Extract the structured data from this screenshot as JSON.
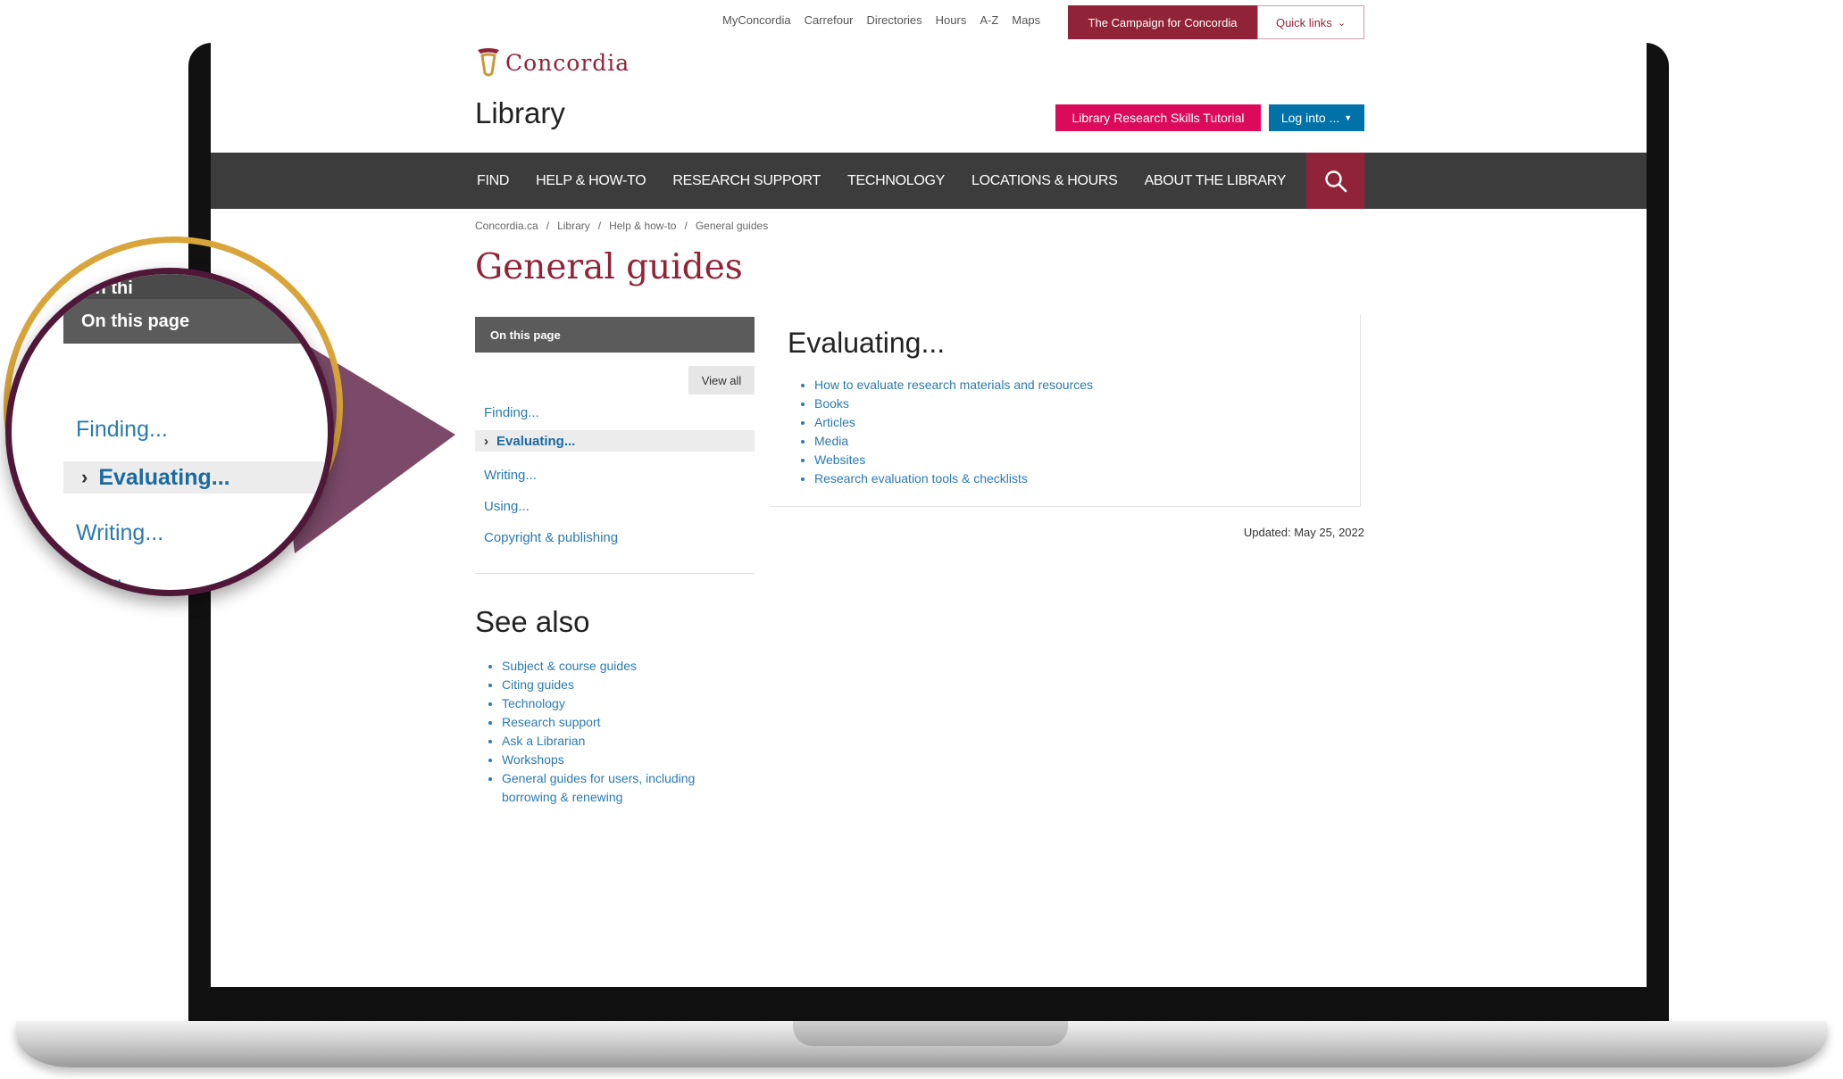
{
  "utility_bar": {
    "links": [
      "MyConcordia",
      "Carrefour",
      "Directories",
      "Hours",
      "A-Z",
      "Maps"
    ],
    "campaign_button": "The Campaign for Concordia",
    "quick_links": "Quick links"
  },
  "logo": {
    "text": "Concordia"
  },
  "site_title": "Library",
  "header_buttons": {
    "tutorial": "Library Research Skills Tutorial",
    "login": "Log into ..."
  },
  "nav": {
    "items": [
      "FIND",
      "HELP & HOW-TO",
      "RESEARCH SUPPORT",
      "TECHNOLOGY",
      "LOCATIONS & HOURS",
      "ABOUT THE LIBRARY"
    ]
  },
  "breadcrumb": [
    "Concordia.ca",
    "Library",
    "Help & how-to",
    "General guides"
  ],
  "page_title": "General guides",
  "sidebar": {
    "header": "On this page",
    "view_all": "View all",
    "items": [
      "Finding...",
      "Evaluating...",
      "Writing...",
      "Using...",
      "Copyright & publishing"
    ],
    "active_index": 1
  },
  "main": {
    "heading": "Evaluating...",
    "links": [
      "How to evaluate research materials and resources",
      "Books",
      "Articles",
      "Media",
      "Websites",
      "Research evaluation tools & checklists"
    ],
    "updated": "Updated: May 25, 2022"
  },
  "see_also": {
    "title": "See also",
    "links": [
      "Subject & course guides",
      "Citing guides",
      "Technology",
      "Research support",
      "Ask a Librarian",
      "Workshops",
      "General guides for users, including borrowing & renewing"
    ]
  },
  "magnifier": {
    "header_top": "On thi",
    "header": "On this page",
    "item_finding": "Finding...",
    "item_evaluating": "Evaluating...",
    "item_writing": "Writing...",
    "item_using_partial": "ing..."
  },
  "colors": {
    "brand_maroon": "#912338",
    "tutorial_pink": "#db0a5b",
    "login_blue": "#0072a8",
    "nav_dark": "#3c3c3c",
    "callout_purple": "#7a4a68"
  }
}
